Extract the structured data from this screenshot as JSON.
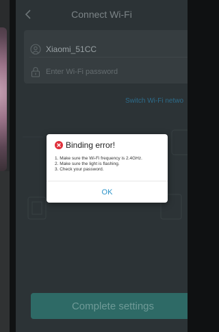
{
  "header": {
    "title": "Connect Wi-Fi",
    "back_icon": "chevron-left-icon"
  },
  "wifi": {
    "ssid": "Xiaomi_51CC",
    "password_placeholder": "Enter Wi-Fi password",
    "ssid_icon": "wifi-user-icon",
    "password_icon": "lock-icon"
  },
  "switch_link": "Switch Wi-Fi netwo",
  "complete_button": "Complete settings",
  "dialog": {
    "title": "Binding error!",
    "icon": "error-x-icon",
    "items": [
      "1.  Make sure the Wi-Fi frequency is 2.4GHz.",
      "2.  Make sure the light is flashing.",
      "3.  Check your password."
    ],
    "ok_label": "OK"
  },
  "colors": {
    "accent": "#2a93c9",
    "error": "#e0303b",
    "button_bg": "#2e6a66"
  }
}
